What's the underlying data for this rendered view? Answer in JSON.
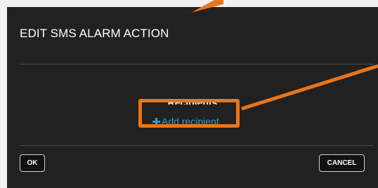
{
  "dialog": {
    "title": "EDIT SMS ALARM ACTION",
    "recipients_label": "Recipients",
    "add_recipient_label": "Add recipient",
    "ok_label": "OK",
    "cancel_label": "CANCEL"
  },
  "annotation": {
    "color": "#e8751a",
    "highlight": "add-recipient-link"
  },
  "icons": {
    "add_icon": "plus-icon"
  }
}
